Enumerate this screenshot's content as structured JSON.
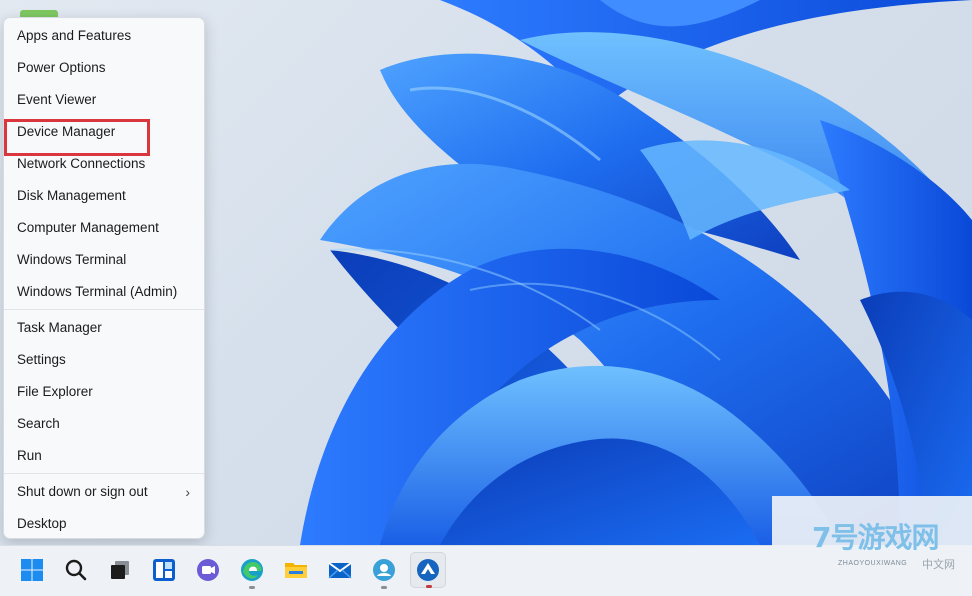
{
  "menu": {
    "groups": [
      [
        "Apps and Features",
        "Power Options",
        "Event Viewer",
        "Device Manager",
        "Network Connections",
        "Disk Management",
        "Computer Management",
        "Windows Terminal",
        "Windows Terminal (Admin)"
      ],
      [
        "Task Manager",
        "Settings",
        "File Explorer",
        "Search",
        "Run"
      ],
      [
        "Shut down or sign out",
        "Desktop"
      ]
    ],
    "highlighted_item": "Device Manager",
    "submenu_item": "Shut down or sign out"
  },
  "taskbar": {
    "icons": [
      {
        "name": "start-icon"
      },
      {
        "name": "search-icon"
      },
      {
        "name": "task-view-icon"
      },
      {
        "name": "widgets-icon"
      },
      {
        "name": "teams-chat-icon"
      },
      {
        "name": "edge-icon"
      },
      {
        "name": "file-explorer-icon"
      },
      {
        "name": "mail-icon"
      },
      {
        "name": "app-icon"
      },
      {
        "name": "active-app-icon"
      }
    ]
  },
  "watermark": {
    "logo": "7号游戏网",
    "subtext": "ZHAOYOUXIWANG",
    "site": "中文网"
  },
  "colors": {
    "highlight_border": "#d9363e",
    "accent_blue": "#1e6fe0",
    "menu_bg": "#f7f9fb"
  }
}
